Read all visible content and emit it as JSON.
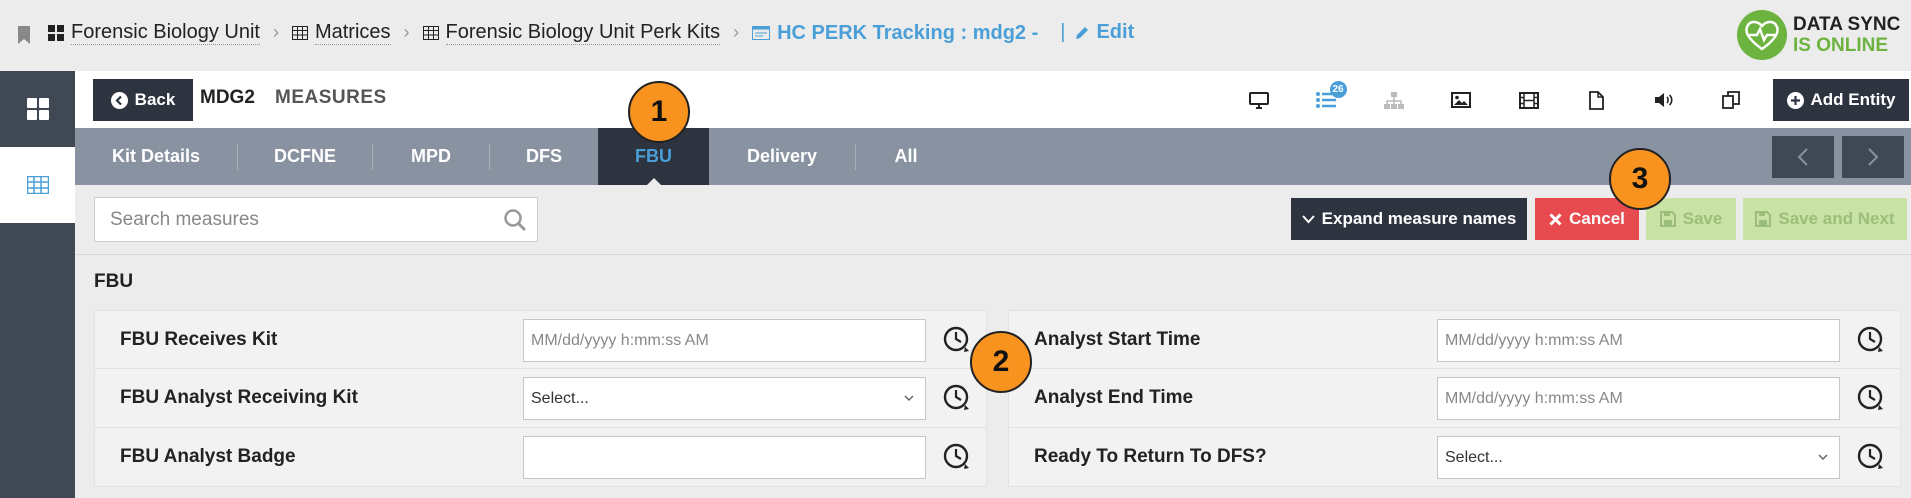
{
  "breadcrumb": {
    "items": [
      {
        "label": "Forensic Biology Unit",
        "icon": "dashboard-icon"
      },
      {
        "label": "Matrices",
        "icon": "table-icon"
      },
      {
        "label": "Forensic Biology Unit Perk Kits",
        "icon": "table-icon"
      }
    ],
    "current": {
      "label": "HC PERK Tracking : mdg2  -",
      "icon": "form-icon"
    },
    "edit_label": "Edit"
  },
  "sync": {
    "line1": "DATA SYNC",
    "line2": "IS ONLINE"
  },
  "header": {
    "back_label": "Back",
    "entity_id": "MDG2",
    "title": "MEASURES",
    "badge_count": "26",
    "add_entity_label": "Add Entity",
    "toolbar_icons": [
      "desktop-icon",
      "list-icon",
      "hierarchy-icon",
      "image-icon",
      "film-icon",
      "document-icon",
      "audio-icon",
      "copy-icon"
    ]
  },
  "tabs": [
    {
      "label": "Kit Details"
    },
    {
      "label": "DCFNE"
    },
    {
      "label": "MPD"
    },
    {
      "label": "DFS"
    },
    {
      "label": "FBU"
    },
    {
      "label": "Delivery"
    },
    {
      "label": "All"
    }
  ],
  "active_tab": "FBU",
  "search": {
    "placeholder": "Search measures"
  },
  "actions": {
    "expand_label": "Expand measure names",
    "cancel_label": "Cancel",
    "save_label": "Save",
    "save_next_label": "Save and Next"
  },
  "section": {
    "title": "FBU"
  },
  "left_fields": [
    {
      "label": "FBU Receives Kit",
      "value": "MM/dd/yyyy h:mm:ss AM",
      "type": "datetime"
    },
    {
      "label": "FBU Analyst Receiving Kit",
      "value": "Select...",
      "type": "select"
    },
    {
      "label": "FBU Analyst Badge",
      "value": "",
      "type": "text"
    }
  ],
  "right_fields": [
    {
      "label": "Analyst Start Time",
      "value": "MM/dd/yyyy h:mm:ss AM",
      "type": "datetime"
    },
    {
      "label": "Analyst End Time",
      "value": "MM/dd/yyyy h:mm:ss AM",
      "type": "datetime"
    },
    {
      "label": "Ready To Return To DFS?",
      "value": "Select...",
      "type": "select"
    }
  ],
  "callouts": [
    "1",
    "2",
    "3"
  ],
  "colors": {
    "accent": "#4a9fd8",
    "dark": "#2d3440",
    "rail": "#3f4853",
    "tabbar": "#8892a0",
    "cancel": "#e84b4f",
    "save_disabled": "#c8e3a5",
    "online": "#6cb33f",
    "callout": "#f7931e"
  }
}
